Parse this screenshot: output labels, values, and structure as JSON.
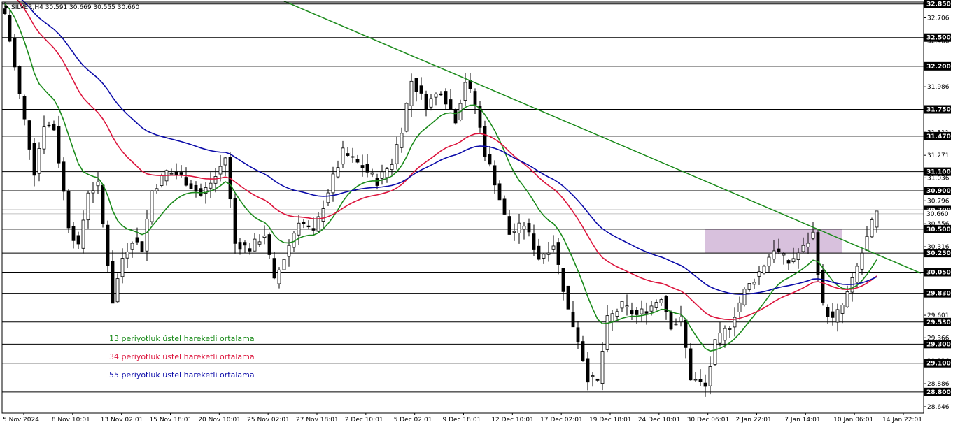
{
  "chart_data": {
    "type": "candlestick",
    "symbol_header": "SILVER,H4",
    "ohlc_text": "30.591 30.669 30.555 30.660",
    "price_axis_ticks": [
      "32.706",
      "32.466",
      "31.986",
      "31.511",
      "31.271",
      "31.036",
      "30.796",
      "30.556",
      "30.316",
      "29.601",
      "29.366",
      "29.126",
      "28.886",
      "28.646"
    ],
    "horizontal_levels": [
      {
        "value": 32.85,
        "label": "32.850"
      },
      {
        "value": 32.5,
        "label": "32.500"
      },
      {
        "value": 32.2,
        "label": "32.200"
      },
      {
        "value": 31.75,
        "label": "31.750"
      },
      {
        "value": 31.47,
        "label": "31.470"
      },
      {
        "value": 31.1,
        "label": "31.100"
      },
      {
        "value": 30.9,
        "label": "30.900"
      },
      {
        "value": 30.7,
        "label": "30.700"
      },
      {
        "value": 30.5,
        "label": "30.500"
      },
      {
        "value": 30.25,
        "label": "30.250"
      },
      {
        "value": 30.05,
        "label": "30.050"
      },
      {
        "value": 29.83,
        "label": "29.830"
      },
      {
        "value": 29.53,
        "label": "29.530"
      },
      {
        "value": 29.3,
        "label": "29.300"
      },
      {
        "value": 29.1,
        "label": "29.100"
      },
      {
        "value": 28.8,
        "label": "28.800"
      }
    ],
    "current_price": {
      "value": 30.66,
      "label": "30.660"
    },
    "y_range": [
      28.58,
      32.87
    ],
    "x_labels": [
      "5 Nov 2024",
      "8 Nov 10:01",
      "13 Nov 02:01",
      "15 Nov 18:01",
      "20 Nov 10:01",
      "25 Nov 02:01",
      "27 Nov 18:01",
      "2 Dec 10:01",
      "5 Dec 02:01",
      "9 Dec 18:01",
      "12 Dec 10:01",
      "17 Dec 02:01",
      "19 Dec 18:01",
      "24 Dec 10:01",
      "30 Dec 06:01",
      "2 Jan 22:01",
      "7 Jan 14:01",
      "10 Jan 06:01",
      "14 Jan 22:01"
    ],
    "trendline": {
      "start": {
        "bar": 57,
        "price": 32.88
      },
      "end": {
        "bar": 187,
        "price": 30.04
      },
      "color": "#1a8a1a"
    },
    "zone": {
      "start_bar": 143,
      "end_bar": 171,
      "low": 30.25,
      "high": 30.5,
      "color": "#d8c1dd"
    },
    "series": [
      {
        "name": "13 periyotluk üstel hareketli ortalama",
        "period": 13,
        "color": "#1a8a1a"
      },
      {
        "name": "34 periyotluk üstel hareketli ortalama",
        "period": 34,
        "color": "#dc143c"
      },
      {
        "name": "55 periyotluk üstel hareketli ortalama",
        "period": 55,
        "color": "#0a0aa8"
      }
    ],
    "close_path": [
      {
        "bar": 0,
        "close": 32.75
      },
      {
        "bar": 3,
        "close": 31.9
      },
      {
        "bar": 6,
        "close": 31.1
      },
      {
        "bar": 8,
        "close": 31.6
      },
      {
        "bar": 10,
        "close": 31.55
      },
      {
        "bar": 13,
        "close": 30.55
      },
      {
        "bar": 15,
        "close": 30.3
      },
      {
        "bar": 17,
        "close": 30.9
      },
      {
        "bar": 19,
        "close": 30.95
      },
      {
        "bar": 22,
        "close": 29.75
      },
      {
        "bar": 24,
        "close": 30.2
      },
      {
        "bar": 26,
        "close": 30.4
      },
      {
        "bar": 28,
        "close": 30.3
      },
      {
        "bar": 30,
        "close": 30.9
      },
      {
        "bar": 33,
        "close": 31.1
      },
      {
        "bar": 36,
        "close": 31.05
      },
      {
        "bar": 40,
        "close": 30.85
      },
      {
        "bar": 43,
        "close": 31.05
      },
      {
        "bar": 45,
        "close": 31.25
      },
      {
        "bar": 47,
        "close": 30.35
      },
      {
        "bar": 50,
        "close": 30.3
      },
      {
        "bar": 53,
        "close": 30.45
      },
      {
        "bar": 55,
        "close": 29.95
      },
      {
        "bar": 57,
        "close": 30.2
      },
      {
        "bar": 60,
        "close": 30.6
      },
      {
        "bar": 63,
        "close": 30.45
      },
      {
        "bar": 66,
        "close": 30.9
      },
      {
        "bar": 69,
        "close": 31.3
      },
      {
        "bar": 73,
        "close": 31.15
      },
      {
        "bar": 76,
        "close": 31.0
      },
      {
        "bar": 79,
        "close": 31.2
      },
      {
        "bar": 81,
        "close": 31.55
      },
      {
        "bar": 83,
        "close": 32.05
      },
      {
        "bar": 86,
        "close": 31.8
      },
      {
        "bar": 89,
        "close": 31.95
      },
      {
        "bar": 92,
        "close": 31.65
      },
      {
        "bar": 94,
        "close": 32.05
      },
      {
        "bar": 96,
        "close": 31.8
      },
      {
        "bar": 98,
        "close": 31.3
      },
      {
        "bar": 100,
        "close": 31.0
      },
      {
        "bar": 103,
        "close": 30.45
      },
      {
        "bar": 106,
        "close": 30.55
      },
      {
        "bar": 109,
        "close": 30.2
      },
      {
        "bar": 112,
        "close": 30.35
      },
      {
        "bar": 115,
        "close": 29.65
      },
      {
        "bar": 117,
        "close": 29.35
      },
      {
        "bar": 119,
        "close": 28.95
      },
      {
        "bar": 121,
        "close": 28.9
      },
      {
        "bar": 123,
        "close": 29.55
      },
      {
        "bar": 126,
        "close": 29.7
      },
      {
        "bar": 129,
        "close": 29.6
      },
      {
        "bar": 132,
        "close": 29.7
      },
      {
        "bar": 134,
        "close": 29.8
      },
      {
        "bar": 136,
        "close": 29.5
      },
      {
        "bar": 138,
        "close": 29.55
      },
      {
        "bar": 140,
        "close": 28.95
      },
      {
        "bar": 143,
        "close": 28.85
      },
      {
        "bar": 145,
        "close": 29.3
      },
      {
        "bar": 148,
        "close": 29.5
      },
      {
        "bar": 151,
        "close": 29.85
      },
      {
        "bar": 154,
        "close": 30.05
      },
      {
        "bar": 157,
        "close": 30.3
      },
      {
        "bar": 160,
        "close": 30.15
      },
      {
        "bar": 163,
        "close": 30.3
      },
      {
        "bar": 165,
        "close": 30.45
      },
      {
        "bar": 167,
        "close": 29.7
      },
      {
        "bar": 169,
        "close": 29.55
      },
      {
        "bar": 171,
        "close": 29.7
      },
      {
        "bar": 173,
        "close": 29.95
      },
      {
        "bar": 175,
        "close": 30.25
      },
      {
        "bar": 177,
        "close": 30.55
      },
      {
        "bar": 178,
        "close": 30.66
      }
    ]
  },
  "legend": [
    {
      "text": "13 periyotluk üstel hareketli ortalama",
      "color": "#1a8a1a"
    },
    {
      "text": "34 periyotluk üstel hareketli ortalama",
      "color": "#dc143c"
    },
    {
      "text": "55 periyotluk üstel hareketli ortalama",
      "color": "#0a0aa8"
    }
  ],
  "colors": {
    "background": "#ffffff",
    "grid_line": "#000000",
    "label_bg": "#000000",
    "current_price_line": "#c0c0c0"
  }
}
